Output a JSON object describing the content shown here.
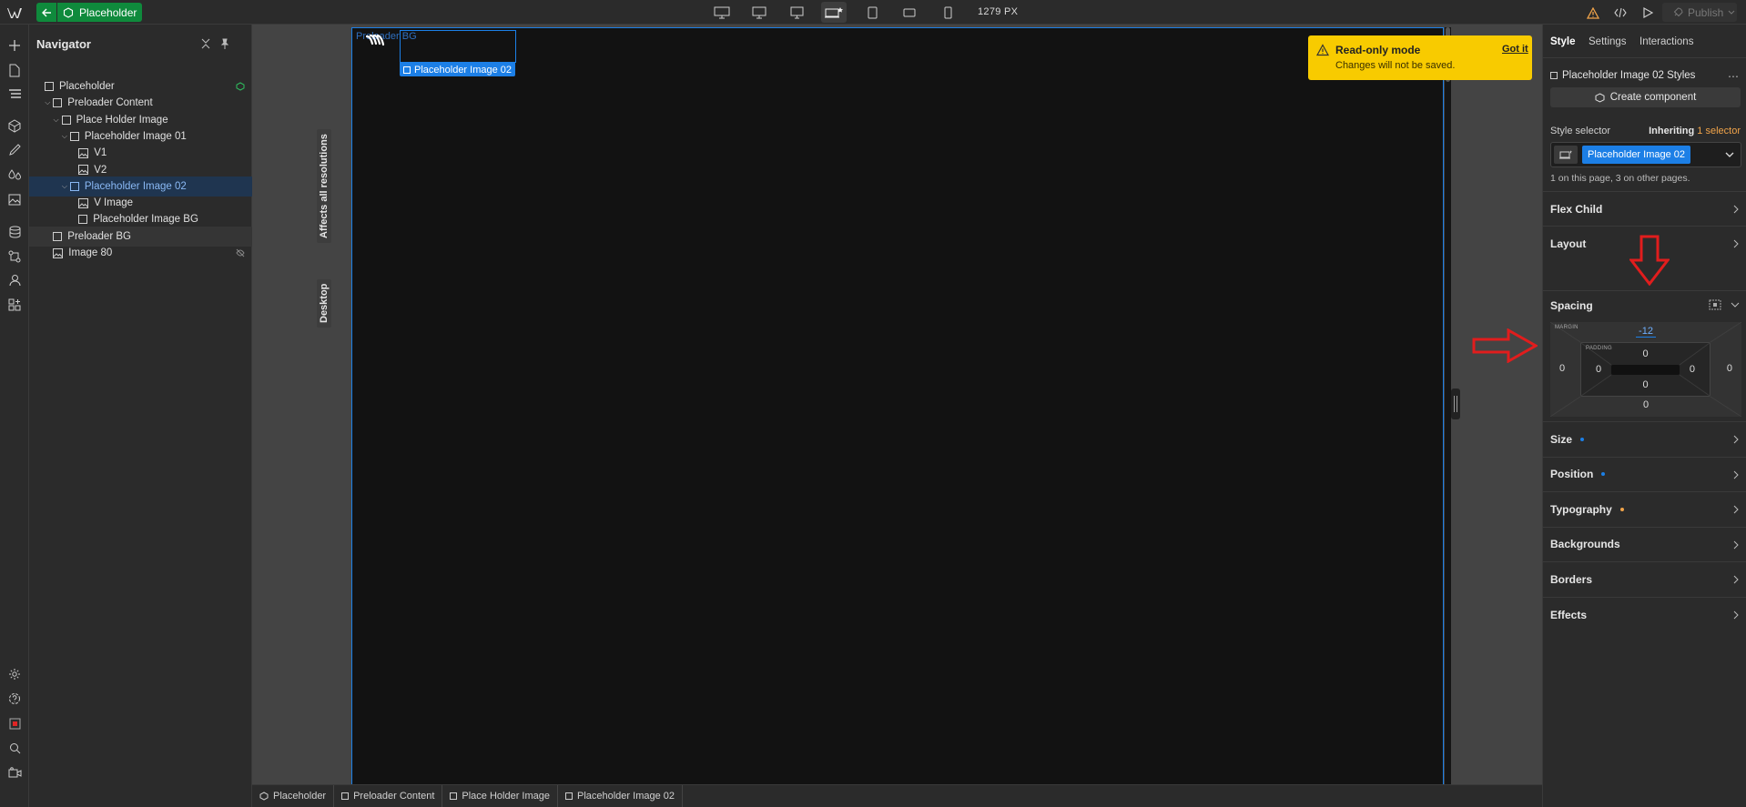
{
  "topbar": {
    "page_name": "Placeholder",
    "width_label": "1279 PX",
    "publish_label": "Publish",
    "breakpoints": [
      "desktop-xl-icon",
      "desktop-lg-icon",
      "desktop-md-icon",
      "desktop-base-icon",
      "tablet-icon",
      "mobile-landscape-icon",
      "mobile-portrait-icon"
    ]
  },
  "navigator": {
    "title": "Navigator",
    "items": [
      {
        "label": "Placeholder",
        "indent": 0,
        "icon": "box",
        "chevron": false
      },
      {
        "label": "Preloader Content",
        "indent": 1,
        "icon": "box",
        "chevron": true
      },
      {
        "label": "Place Holder Image",
        "indent": 2,
        "icon": "box",
        "chevron": true
      },
      {
        "label": "Placeholder Image 01",
        "indent": 3,
        "icon": "box",
        "chevron": true
      },
      {
        "label": "V1",
        "indent": 4,
        "icon": "image",
        "chevron": false
      },
      {
        "label": "V2",
        "indent": 4,
        "icon": "image",
        "chevron": false
      },
      {
        "label": "Placeholder Image 02",
        "indent": 3,
        "icon": "box",
        "chevron": true,
        "selected": true
      },
      {
        "label": "V Image",
        "indent": 4,
        "icon": "image",
        "chevron": false
      },
      {
        "label": "Placeholder Image BG",
        "indent": 4,
        "icon": "box",
        "chevron": false
      },
      {
        "label": "Preloader BG",
        "indent": 1,
        "icon": "box",
        "chevron": false,
        "highlight": true
      },
      {
        "label": "Image 80",
        "indent": 1,
        "icon": "image",
        "chevron": false,
        "hidden": true
      }
    ]
  },
  "canvas": {
    "vertical_label_1": "Affects all resolutions",
    "vertical_label_2": "Desktop",
    "element_label": "Preloader BG",
    "selected_tag": "Placeholder Image 02"
  },
  "readonly": {
    "title": "Read-only mode",
    "subtitle": "Changes will not be saved.",
    "action": "Got it"
  },
  "breadcrumb": [
    "Placeholder",
    "Preloader Content",
    "Place Holder Image",
    "Placeholder Image 02"
  ],
  "style_panel": {
    "tabs": [
      "Style",
      "Settings",
      "Interactions"
    ],
    "styles_title": "Placeholder Image 02 Styles",
    "create_component": "Create component",
    "selector_label": "Style selector",
    "inheriting": "Inheriting",
    "inheriting_count": "1 selector",
    "selector_pill": "Placeholder Image 02",
    "pages_note": "1 on this page, 3 on other pages.",
    "sections_top": [
      "Flex Child",
      "Layout"
    ],
    "spacing": {
      "title": "Spacing",
      "margin_label": "MARGIN",
      "padding_label": "PADDING",
      "margin": {
        "top": "-12",
        "right": "0",
        "bottom": "0",
        "left": "0"
      },
      "padding": {
        "top": "0",
        "right": "0",
        "bottom": "0",
        "left": "0"
      }
    },
    "sections_bottom": [
      {
        "label": "Size",
        "dot": "#1c7fe6"
      },
      {
        "label": "Position",
        "dot": "#1c7fe6"
      },
      {
        "label": "Typography",
        "dot": "#f1a44a"
      },
      {
        "label": "Backgrounds",
        "dot": ""
      },
      {
        "label": "Borders",
        "dot": ""
      },
      {
        "label": "Effects",
        "dot": ""
      }
    ]
  },
  "colors": {
    "accent": "#1c7fe6",
    "brand_green": "#0f8a3c",
    "warning": "#f8cb00",
    "annotation_red": "#e11d1d"
  }
}
